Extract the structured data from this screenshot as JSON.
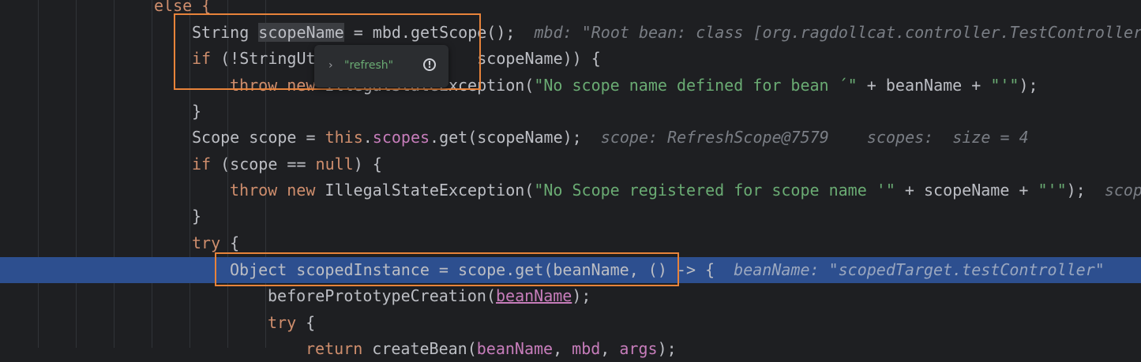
{
  "lines": [
    {
      "id": "l0",
      "segments": [
        {
          "t": "else {",
          "c": "kw"
        }
      ]
    },
    {
      "id": "l1",
      "segments": [
        {
          "t": "String "
        },
        {
          "t": "scopeName",
          "c": "hl-var"
        },
        {
          "t": " = mbd.getScope();"
        },
        {
          "t": "  mbd: \"Root bean: class [org.ragdollcat.controller.TestController",
          "c": "hint"
        }
      ]
    },
    {
      "id": "l2",
      "segments": [
        {
          "t": "if",
          "c": "kw"
        },
        {
          "t": " (!StringUt"
        },
        {
          "t": "                 "
        },
        {
          "t": "scopeName)) {"
        }
      ]
    },
    {
      "id": "l3",
      "segments": [
        {
          "t": "throw new",
          "c": "kw"
        },
        {
          "t": " IllegalStateException("
        },
        {
          "t": "\"No scope name defined for bean ´\"",
          "c": "str"
        },
        {
          "t": " + beanName + "
        },
        {
          "t": "\"'\"",
          "c": "str"
        },
        {
          "t": ");"
        }
      ]
    },
    {
      "id": "l4",
      "segments": [
        {
          "t": "}"
        }
      ]
    },
    {
      "id": "l5",
      "segments": [
        {
          "t": "Scope scope = "
        },
        {
          "t": "this",
          "c": "kw"
        },
        {
          "t": "."
        },
        {
          "t": "scopes",
          "c": "fld"
        },
        {
          "t": ".get(scopeName);"
        },
        {
          "t": "  scope: RefreshScope@7579    scopes:  size = 4",
          "c": "hint"
        }
      ]
    },
    {
      "id": "l6",
      "segments": [
        {
          "t": "if",
          "c": "kw"
        },
        {
          "t": " (scope == "
        },
        {
          "t": "null",
          "c": "kw"
        },
        {
          "t": ") {"
        }
      ]
    },
    {
      "id": "l7",
      "segments": [
        {
          "t": "throw new",
          "c": "kw"
        },
        {
          "t": " IllegalStateException("
        },
        {
          "t": "\"No Scope registered for scope name '\"",
          "c": "str"
        },
        {
          "t": " + scopeName + "
        },
        {
          "t": "\"'\"",
          "c": "str"
        },
        {
          "t": ");"
        },
        {
          "t": "  scop",
          "c": "hint"
        }
      ]
    },
    {
      "id": "l8",
      "segments": [
        {
          "t": "}"
        }
      ]
    },
    {
      "id": "l9",
      "segments": [
        {
          "t": "try",
          "c": "kw"
        },
        {
          "t": " {"
        }
      ]
    },
    {
      "id": "l10",
      "segments": [
        {
          "t": "Object scopedInstance = scope.get(beanName, () -> {"
        },
        {
          "t": "  beanName: \"scopedTarget.testController\"",
          "c": "hint"
        }
      ]
    },
    {
      "id": "l11",
      "segments": [
        {
          "t": "beforePrototypeCreation("
        },
        {
          "t": "beanName",
          "c": "ul"
        },
        {
          "t": ");"
        }
      ]
    },
    {
      "id": "l12",
      "segments": [
        {
          "t": "try",
          "c": "kw"
        },
        {
          "t": " {"
        }
      ]
    },
    {
      "id": "l13",
      "segments": [
        {
          "t": "return",
          "c": "kw"
        },
        {
          "t": " createBean("
        },
        {
          "t": "beanName",
          "c": "fld"
        },
        {
          "t": ", "
        },
        {
          "t": "mbd",
          "c": "fld"
        },
        {
          "t": ", "
        },
        {
          "t": "args",
          "c": "fld"
        },
        {
          "t": ");"
        }
      ]
    }
  ],
  "popup": {
    "value": "\"refresh\"",
    "expand_icon": "chevron-right-icon",
    "info_icon": "info-icon"
  },
  "colors": {
    "highlight_box": "#e8833a",
    "exec_line": "#2d4f8f",
    "background": "#1e1f22"
  }
}
